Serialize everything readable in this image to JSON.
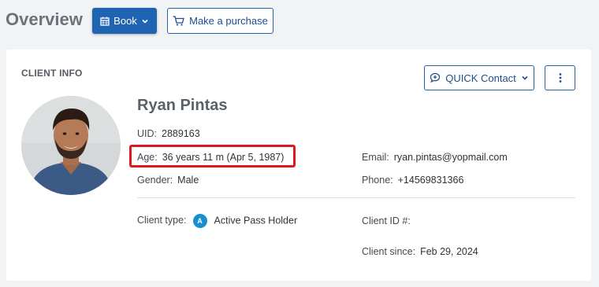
{
  "header": {
    "title": "Overview",
    "book_label": "Book",
    "purchase_label": "Make a purchase"
  },
  "client_info": {
    "section_label": "CLIENT INFO",
    "quick_contact_label": "QUICK Contact",
    "name": "Ryan Pintas",
    "uid_label": "UID:",
    "uid": "2889163",
    "age_label": "Age:",
    "age": "36 years 11 m (Apr 5, 1987)",
    "gender_label": "Gender:",
    "gender": "Male",
    "email_label": "Email:",
    "email": "ryan.pintas@yopmail.com",
    "phone_label": "Phone:",
    "phone": "+14569831366",
    "client_type_label": "Client type:",
    "client_type_badge": "A",
    "client_type": "Active Pass Holder",
    "client_id_label": "Client ID #:",
    "client_since_label": "Client since:",
    "client_since": "Feb 29, 2024"
  },
  "colors": {
    "primary": "#1f63b3",
    "highlight": "#e0191d",
    "badge": "#1a8fd0"
  },
  "icons": [
    "calendar-icon",
    "chevron-down-icon",
    "cart-icon",
    "chat-icon",
    "kebab-menu-icon"
  ]
}
